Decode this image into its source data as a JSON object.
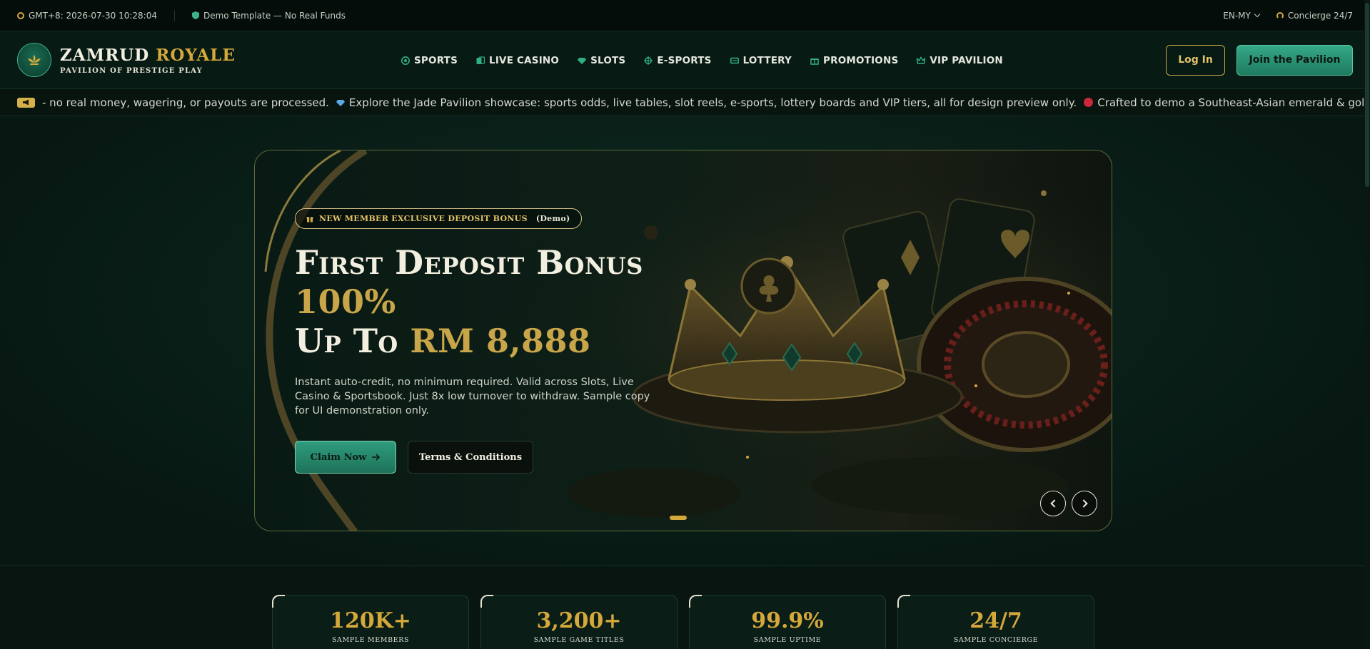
{
  "topbar": {
    "clock": "GMT+8: 2026-07-30 10:28:04",
    "template_notice": "Demo Template — No Real Funds",
    "language": "EN-MY",
    "concierge": "Concierge 24/7"
  },
  "header": {
    "brand_main": "ZAMRUD",
    "brand_accent": "ROYALE",
    "brand_tagline": "PAVILION OF PRESTIGE PLAY",
    "nav": [
      {
        "label": "SPORTS",
        "icon": "soccer-ball-icon"
      },
      {
        "label": "LIVE CASINO",
        "icon": "cards-icon"
      },
      {
        "label": "SLOTS",
        "icon": "gem-icon"
      },
      {
        "label": "E-SPORTS",
        "icon": "gamepad-icon"
      },
      {
        "label": "LOTTERY",
        "icon": "ticket-icon"
      },
      {
        "label": "PROMOTIONS",
        "icon": "gift-icon"
      },
      {
        "label": "VIP PAVILION",
        "icon": "crown-icon"
      }
    ],
    "login_label": "Log In",
    "join_label": "Join the Pavilion"
  },
  "ticker": {
    "items": [
      "- no real money, wagering, or payouts are processed.",
      "Explore the Jade Pavilion showcase: sports odds, live tables, slot reels, e-sports, lottery boards and VIP tiers, all for design preview only.",
      "Crafted to demo a Southeast-Asian emerald & gold gaming aesthetic."
    ]
  },
  "hero": {
    "pill_label": "NEW MEMBER EXCLUSIVE DEPOSIT BONUS",
    "pill_tag": "(Demo)",
    "title_line1": "First Deposit Bonus",
    "title_line2": "100%",
    "title_line3_prefix": "Up To",
    "title_line3_amount": "RM 8,888",
    "description": "Instant auto-credit, no minimum required. Valid across Slots, Live Casino & Sportsbook. Just 8x low turnover to withdraw. Sample copy for UI demonstration only.",
    "claim_label": "Claim Now",
    "terms_label": "Terms & Conditions"
  },
  "stats": [
    {
      "value": "120K+",
      "label": "SAMPLE MEMBERS"
    },
    {
      "value": "3,200+",
      "label": "SAMPLE GAME TITLES"
    },
    {
      "value": "99.9%",
      "label": "SAMPLE UPTIME"
    },
    {
      "value": "24/7",
      "label": "SAMPLE CONCIERGE"
    }
  ],
  "colors": {
    "emerald": "#2f9c7d",
    "gold": "#d4a83a",
    "background": "#071712"
  }
}
